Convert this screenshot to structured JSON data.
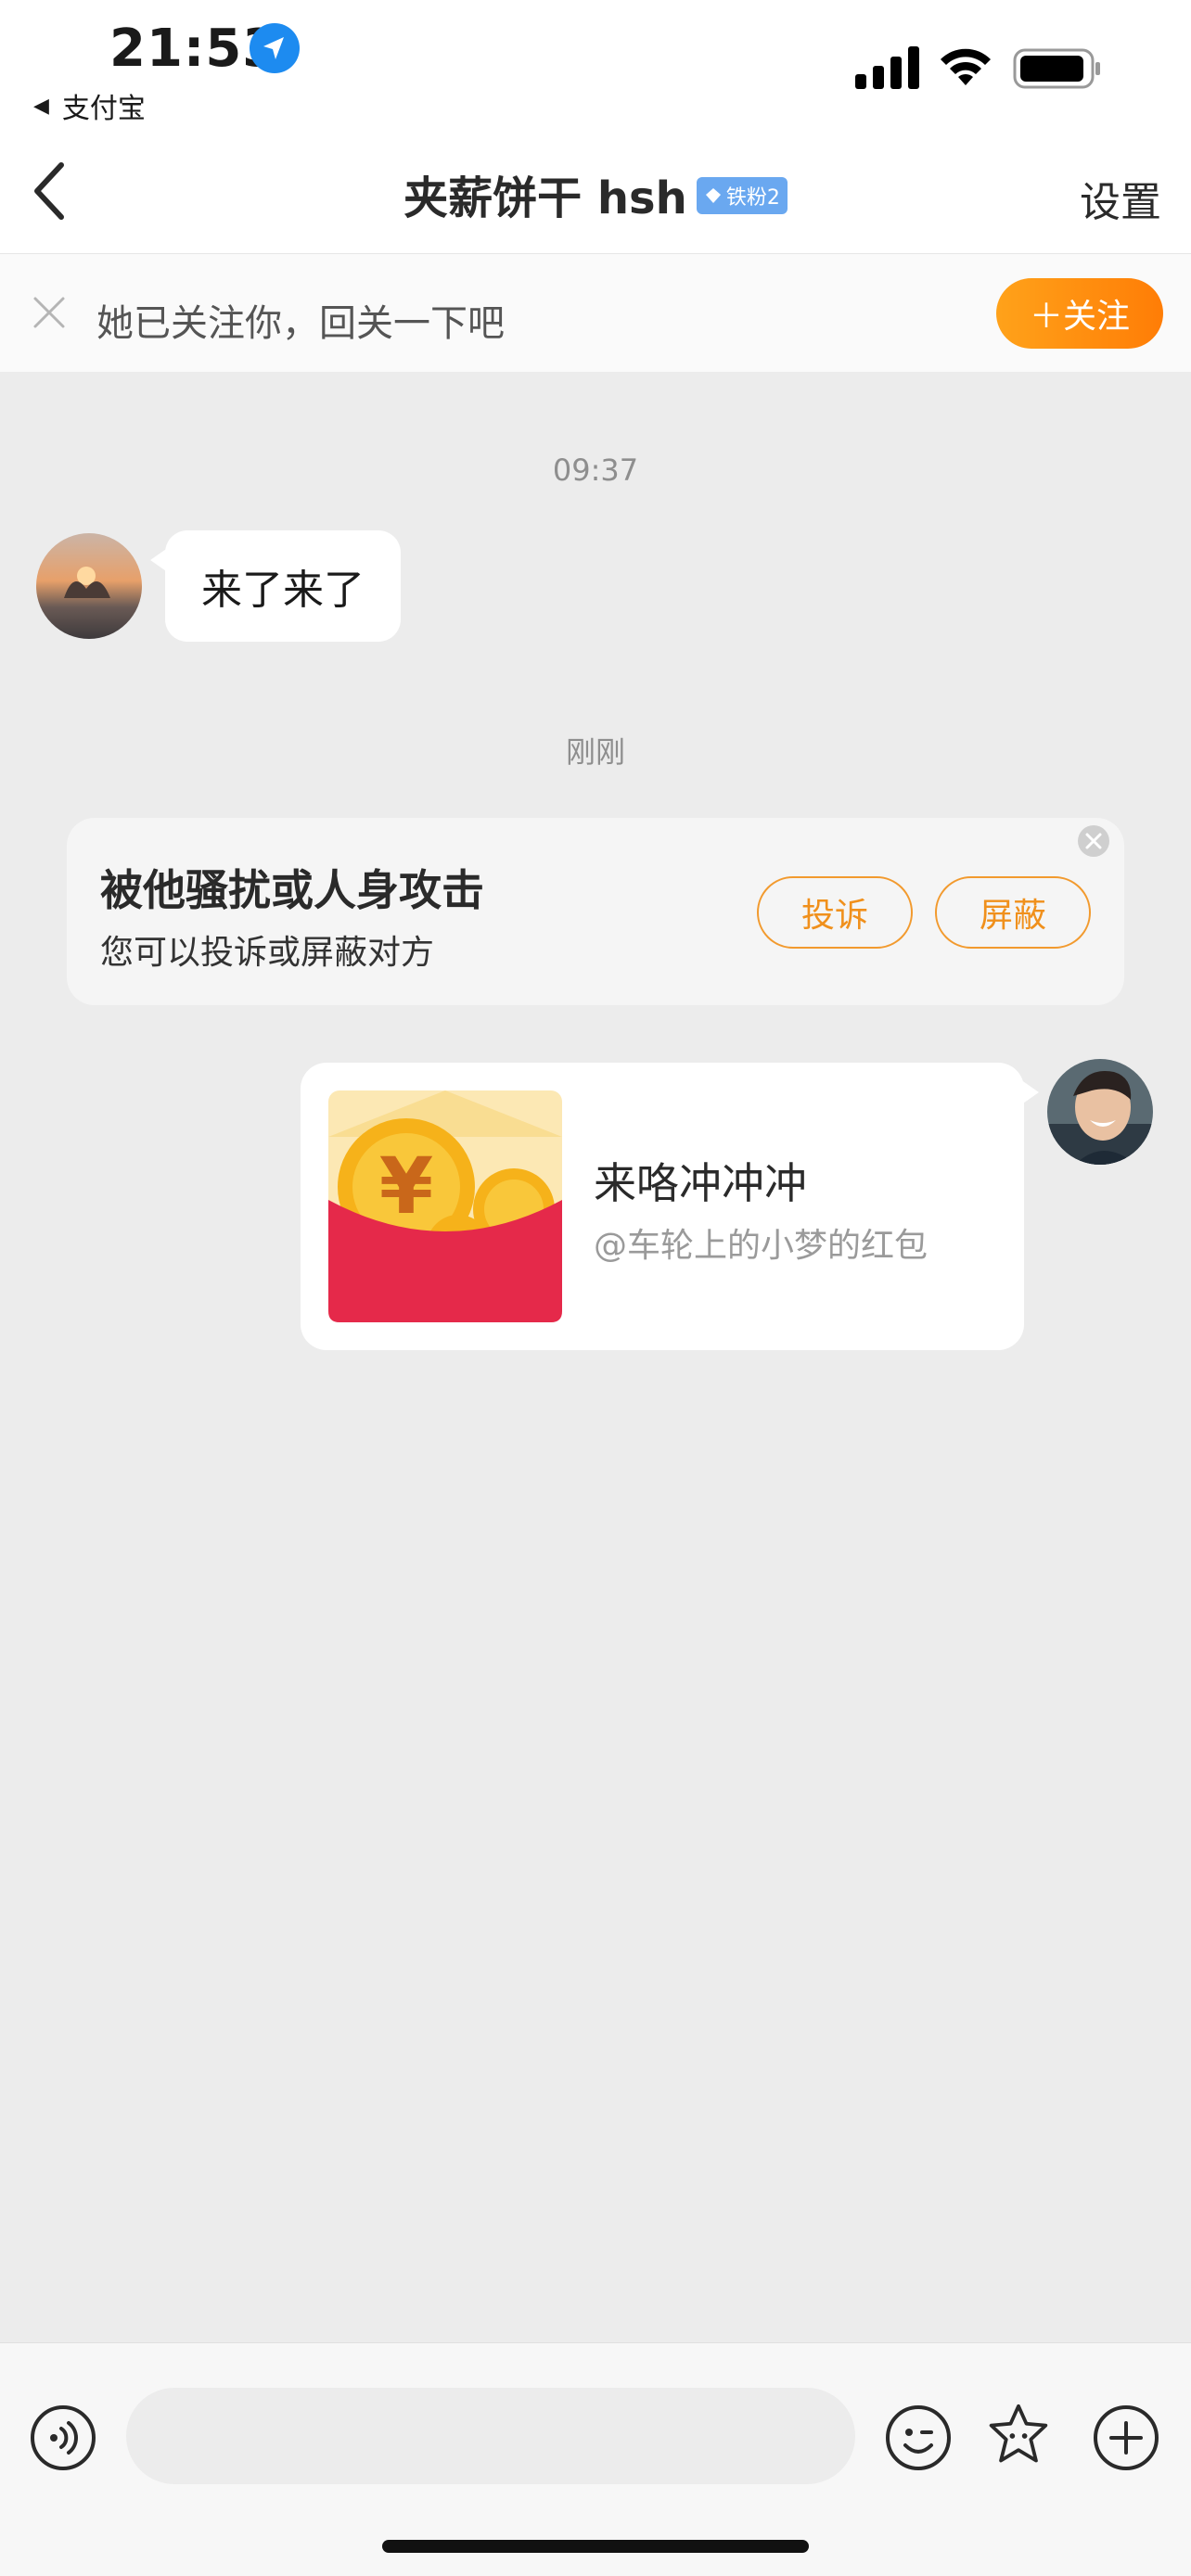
{
  "status_bar": {
    "time": "21:53",
    "back_app": "支付宝"
  },
  "nav": {
    "title": "夹薪饼干 hsh",
    "badge": "铁粉2",
    "settings": "设置"
  },
  "follow_bar": {
    "text": "她已关注你，回关一下吧",
    "button": "＋关注",
    "accent_color": "#ff8c10"
  },
  "messages": {
    "timestamp_1": "09:37",
    "incoming_text": "来了来了",
    "timestamp_2": "刚刚"
  },
  "warning_card": {
    "title": "被他骚扰或人身攻击",
    "subtitle": "您可以投诉或屏蔽对方",
    "report_button": "投诉",
    "block_button": "屏蔽"
  },
  "red_packet": {
    "title": "来咯冲冲冲",
    "subtitle": "@车轮上的小梦的红包",
    "color": "#e5294a"
  },
  "input_bar": {
    "placeholder": ""
  }
}
